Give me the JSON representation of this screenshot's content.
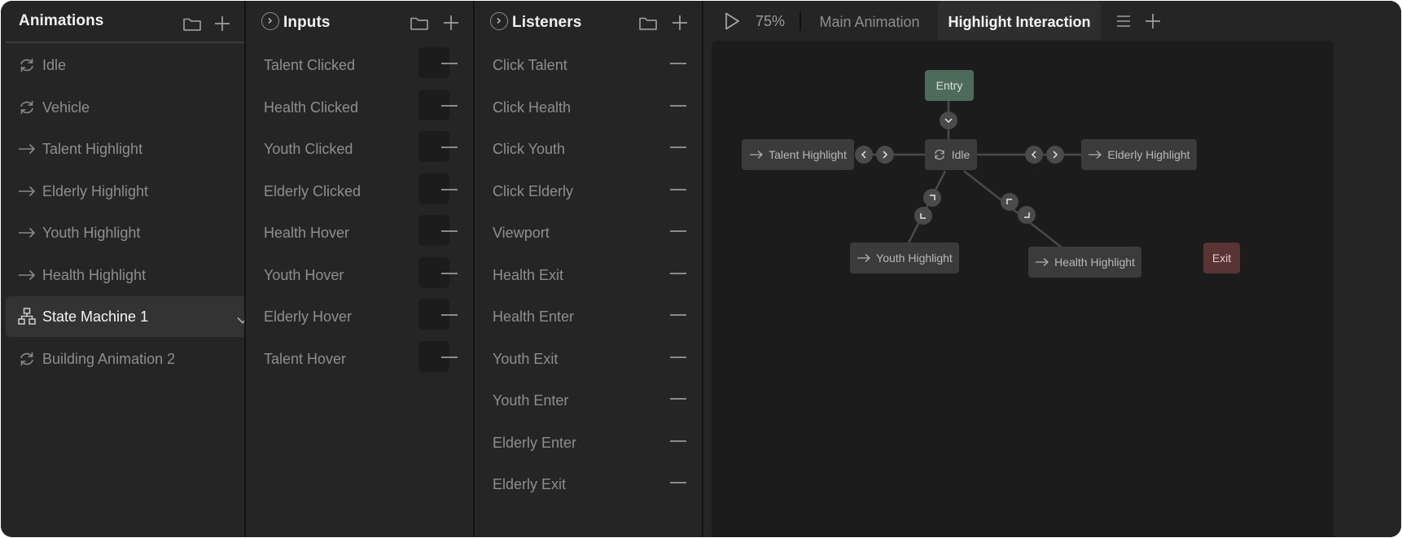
{
  "animations_panel": {
    "title": "Animations",
    "items": [
      {
        "label": "Idle",
        "icon": "loop-icon",
        "selected": false
      },
      {
        "label": "Vehicle",
        "icon": "loop-icon",
        "selected": false
      },
      {
        "label": "Talent Highlight",
        "icon": "arrow-right-icon",
        "selected": false
      },
      {
        "label": "Elderly Highlight",
        "icon": "arrow-right-icon",
        "selected": false
      },
      {
        "label": "Youth Highlight",
        "icon": "arrow-right-icon",
        "selected": false
      },
      {
        "label": "Health Highlight",
        "icon": "arrow-right-icon",
        "selected": false
      },
      {
        "label": "State Machine 1",
        "icon": "state-machine-icon",
        "selected": true
      },
      {
        "label": "Building Animation 2",
        "icon": "loop-icon",
        "selected": false
      }
    ]
  },
  "inputs_panel": {
    "title": "Inputs",
    "items": [
      {
        "label": "Talent Clicked"
      },
      {
        "label": "Health Clicked"
      },
      {
        "label": "Youth Clicked"
      },
      {
        "label": "Elderly Clicked"
      },
      {
        "label": "Health Hover"
      },
      {
        "label": "Youth Hover"
      },
      {
        "label": "Elderly Hover"
      },
      {
        "label": "Talent Hover"
      }
    ]
  },
  "listeners_panel": {
    "title": "Listeners",
    "items": [
      {
        "label": "Click Talent"
      },
      {
        "label": "Click Health"
      },
      {
        "label": "Click Youth"
      },
      {
        "label": "Click Elderly"
      },
      {
        "label": "Viewport"
      },
      {
        "label": "Health Exit"
      },
      {
        "label": "Health Enter"
      },
      {
        "label": "Youth Exit"
      },
      {
        "label": "Youth Enter"
      },
      {
        "label": "Elderly Enter"
      },
      {
        "label": "Elderly Exit"
      }
    ]
  },
  "graph": {
    "zoom": "75%",
    "tabs": [
      {
        "label": "Main Animation",
        "active": false
      },
      {
        "label": "Highlight Interaction",
        "active": true
      }
    ],
    "nodes": {
      "entry": "Entry",
      "idle": "Idle",
      "talent": "Talent Highlight",
      "elderly": "Elderly Highlight",
      "youth": "Youth Highlight",
      "health": "Health Highlight",
      "exit": "Exit"
    }
  },
  "colors": {
    "background": "#252525",
    "canvas": "#1c1c1c",
    "entry_node": "#4e6a5a",
    "exit_node": "#5a3434",
    "selected_item": "#333333"
  }
}
